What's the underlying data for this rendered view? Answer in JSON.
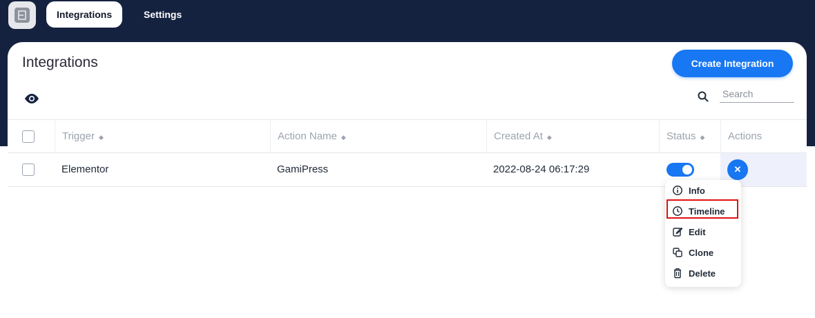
{
  "nav": {
    "logo_icon": "app-logo-icon",
    "tabs": [
      {
        "label": "Integrations",
        "active": true
      },
      {
        "label": "Settings",
        "active": false
      }
    ]
  },
  "page": {
    "title": "Integrations",
    "create_button": "Create Integration",
    "search_placeholder": "Search"
  },
  "table": {
    "columns": [
      "Trigger",
      "Action Name",
      "Created At",
      "Status",
      "Actions"
    ],
    "rows": [
      {
        "trigger": "Elementor",
        "action_name": "GamiPress",
        "created_at": "2022-08-24 06:17:29",
        "status": true
      }
    ]
  },
  "actions_menu": {
    "items": [
      {
        "label": "Info",
        "icon": "info-icon"
      },
      {
        "label": "Timeline",
        "icon": "clock-icon"
      },
      {
        "label": "Edit",
        "icon": "edit-icon"
      },
      {
        "label": "Clone",
        "icon": "copy-icon"
      },
      {
        "label": "Delete",
        "icon": "trash-icon"
      }
    ],
    "highlighted": "Timeline"
  },
  "colors": {
    "topbar": "#15223f",
    "accent": "#1877f2",
    "highlight": "#e01010"
  }
}
